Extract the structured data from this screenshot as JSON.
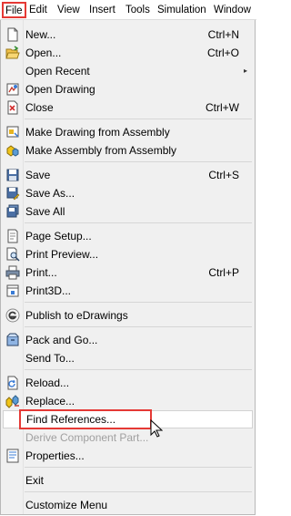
{
  "menubar": {
    "items": [
      {
        "label": "File"
      },
      {
        "label": "Edit"
      },
      {
        "label": "View"
      },
      {
        "label": "Insert"
      },
      {
        "label": "Tools"
      },
      {
        "label": "Simulation"
      },
      {
        "label": "Window"
      }
    ],
    "active": "File"
  },
  "menu": {
    "items": [
      {
        "label": "New...",
        "shortcut": "Ctrl+N",
        "icon": "new-document-icon"
      },
      {
        "label": "Open...",
        "shortcut": "Ctrl+O",
        "icon": "open-folder-icon"
      },
      {
        "label": "Open Recent",
        "submenu_arrow": "▸"
      },
      {
        "label": "Open Drawing",
        "icon": "open-drawing-icon"
      },
      {
        "label": "Close",
        "shortcut": "Ctrl+W",
        "icon": "close-document-icon"
      },
      {
        "label": "Make Drawing from Assembly",
        "icon": "make-drawing-icon"
      },
      {
        "label": "Make Assembly from Assembly",
        "icon": "make-assembly-icon"
      },
      {
        "label": "Save",
        "shortcut": "Ctrl+S",
        "icon": "save-icon"
      },
      {
        "label": "Save As...",
        "icon": "save-as-icon"
      },
      {
        "label": "Save All",
        "icon": "save-all-icon"
      },
      {
        "label": "Page Setup...",
        "icon": "page-setup-icon"
      },
      {
        "label": "Print Preview...",
        "icon": "print-preview-icon"
      },
      {
        "label": "Print...",
        "shortcut": "Ctrl+P",
        "icon": "print-icon"
      },
      {
        "label": "Print3D...",
        "icon": "print3d-icon"
      },
      {
        "label": "Publish to eDrawings",
        "icon": "edrawings-icon"
      },
      {
        "label": "Pack and Go...",
        "icon": "pack-and-go-icon"
      },
      {
        "label": "Send To..."
      },
      {
        "label": "Reload...",
        "icon": "reload-icon"
      },
      {
        "label": "Replace...",
        "icon": "replace-icon"
      },
      {
        "label": "Find References...",
        "state": "highlighted"
      },
      {
        "label": "Derive Component Part...",
        "state": "disabled"
      },
      {
        "label": "Properties...",
        "icon": "properties-icon"
      },
      {
        "label": "Exit"
      },
      {
        "label": "Customize Menu"
      }
    ]
  },
  "colors": {
    "menu_background": "#f0f0f0",
    "annotation_red": "#e53935",
    "disabled_text": "#a0a0a0"
  }
}
